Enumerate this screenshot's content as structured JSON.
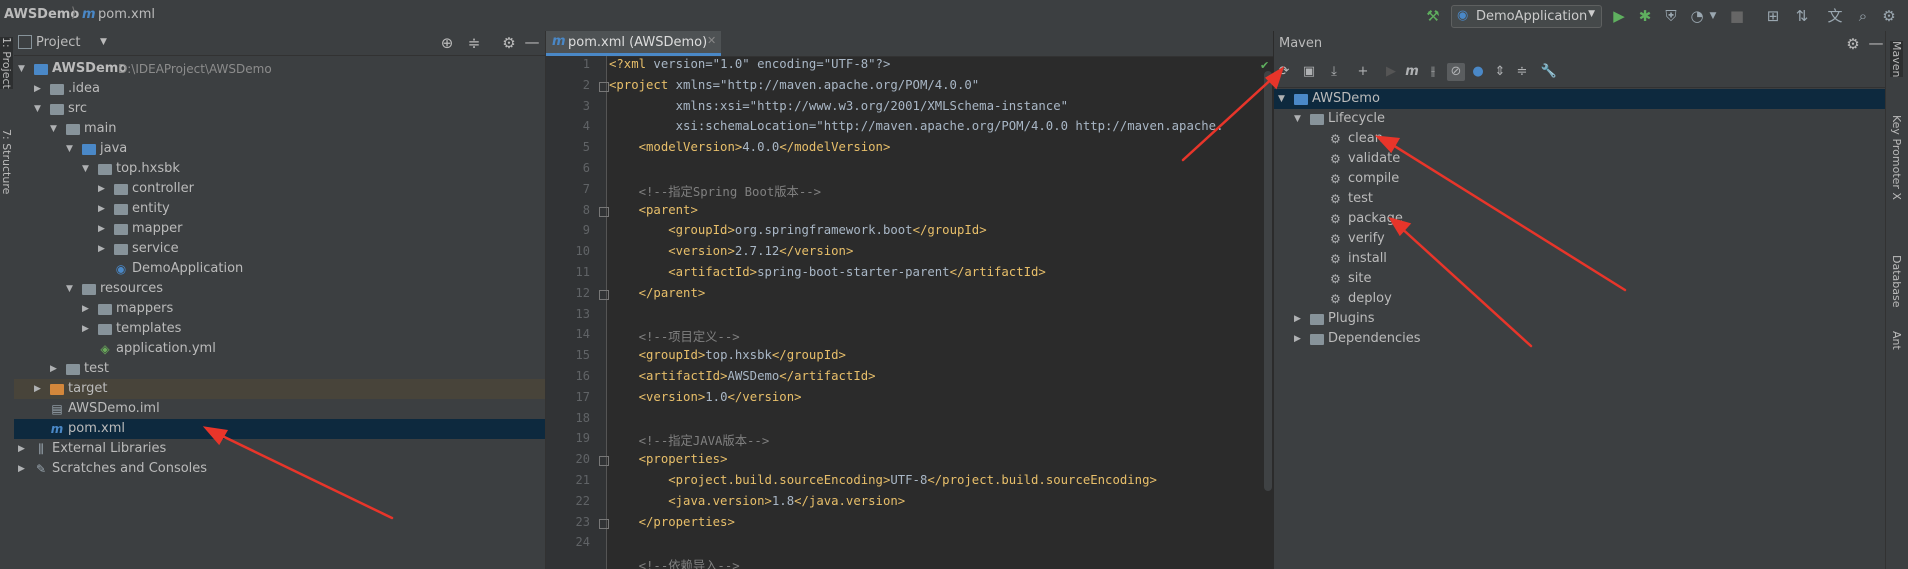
{
  "navbar": {
    "project": "AWSDemo",
    "file": "pom.xml",
    "run_config": "DemoApplication"
  },
  "left_stripe": {
    "project_tab": "1: Project",
    "structure_tab": "7: Structure"
  },
  "project": {
    "header_label": "Project",
    "tree": [
      {
        "label": "AWSDemo",
        "hint": "D:\\IDEAProject\\AWSDemo",
        "depth": 0,
        "arrow": "open",
        "kind": "module"
      },
      {
        "label": ".idea",
        "depth": 1,
        "arrow": "closed",
        "kind": "folder"
      },
      {
        "label": "src",
        "depth": 1,
        "arrow": "open",
        "kind": "folder"
      },
      {
        "label": "main",
        "depth": 2,
        "arrow": "open",
        "kind": "folder"
      },
      {
        "label": "java",
        "depth": 3,
        "arrow": "open",
        "kind": "blue"
      },
      {
        "label": "top.hxsbk",
        "depth": 4,
        "arrow": "open",
        "kind": "folder"
      },
      {
        "label": "controller",
        "depth": 5,
        "arrow": "closed",
        "kind": "folder"
      },
      {
        "label": "entity",
        "depth": 5,
        "arrow": "closed",
        "kind": "folder"
      },
      {
        "label": "mapper",
        "depth": 5,
        "arrow": "closed",
        "kind": "folder"
      },
      {
        "label": "service",
        "depth": 5,
        "arrow": "closed",
        "kind": "folder"
      },
      {
        "label": "DemoApplication",
        "depth": 5,
        "arrow": "none",
        "kind": "spring"
      },
      {
        "label": "resources",
        "depth": 3,
        "arrow": "open",
        "kind": "folder"
      },
      {
        "label": "mappers",
        "depth": 4,
        "arrow": "closed",
        "kind": "folder"
      },
      {
        "label": "templates",
        "depth": 4,
        "arrow": "closed",
        "kind": "folder"
      },
      {
        "label": "application.yml",
        "depth": 4,
        "arrow": "none",
        "kind": "yml"
      },
      {
        "label": "test",
        "depth": 2,
        "arrow": "closed",
        "kind": "folder"
      },
      {
        "label": "target",
        "depth": 1,
        "arrow": "closed",
        "kind": "orange"
      },
      {
        "label": "AWSDemo.iml",
        "depth": 1,
        "arrow": "none",
        "kind": "iml"
      },
      {
        "label": "pom.xml",
        "depth": 1,
        "arrow": "none",
        "kind": "maven"
      },
      {
        "label": "External Libraries",
        "depth": 0,
        "arrow": "closed",
        "kind": "lib"
      },
      {
        "label": "Scratches and Consoles",
        "depth": 0,
        "arrow": "closed",
        "kind": "scratch"
      }
    ]
  },
  "editor": {
    "tab_label": "pom.xml (AWSDemo)",
    "line_numbers": [
      "1",
      "2",
      "3",
      "4",
      "5",
      "6",
      "7",
      "8",
      "9",
      "10",
      "11",
      "12",
      "13",
      "14",
      "15",
      "16",
      "17",
      "18",
      "19",
      "20",
      "21",
      "22",
      "23",
      "24"
    ],
    "lines": [
      "<?xml version=\"1.0\" encoding=\"UTF-8\"?>",
      "<project xmlns=\"http://maven.apache.org/POM/4.0.0\"",
      "         xmlns:xsi=\"http://www.w3.org/2001/XMLSchema-instance\"",
      "         xsi:schemaLocation=\"http://maven.apache.org/POM/4.0.0 http://maven.apache.",
      "    <modelVersion>4.0.0</modelVersion>",
      "",
      "    <!--指定Spring Boot版本-->",
      "    <parent>",
      "        <groupId>org.springframework.boot</groupId>",
      "        <version>2.7.12</version>",
      "        <artifactId>spring-boot-starter-parent</artifactId>",
      "    </parent>",
      "",
      "    <!--项目定义-->",
      "    <groupId>top.hxsbk</groupId>",
      "    <artifactId>AWSDemo</artifactId>",
      "    <version>1.0</version>",
      "",
      "    <!--指定JAVA版本-->",
      "    <properties>",
      "        <project.build.sourceEncoding>UTF-8</project.build.sourceEncoding>",
      "        <java.version>1.8</java.version>",
      "    </properties>",
      "",
      "    <!--依赖导入-->"
    ]
  },
  "maven": {
    "title": "Maven",
    "root": "AWSDemo",
    "lifecycle_label": "Lifecycle",
    "phases": [
      "clean",
      "validate",
      "compile",
      "test",
      "package",
      "verify",
      "install",
      "site",
      "deploy"
    ],
    "plugins_label": "Plugins",
    "dependencies_label": "Dependencies"
  },
  "right_stripe": {
    "maven_tab": "Maven",
    "key_promoter_tab": "Key Promoter X",
    "database_tab": "Database",
    "ant_tab": "Ant"
  },
  "colors": {
    "annotation_arrow": "#e8352a",
    "selection": "#0d293e",
    "accent": "#4a88c7"
  }
}
